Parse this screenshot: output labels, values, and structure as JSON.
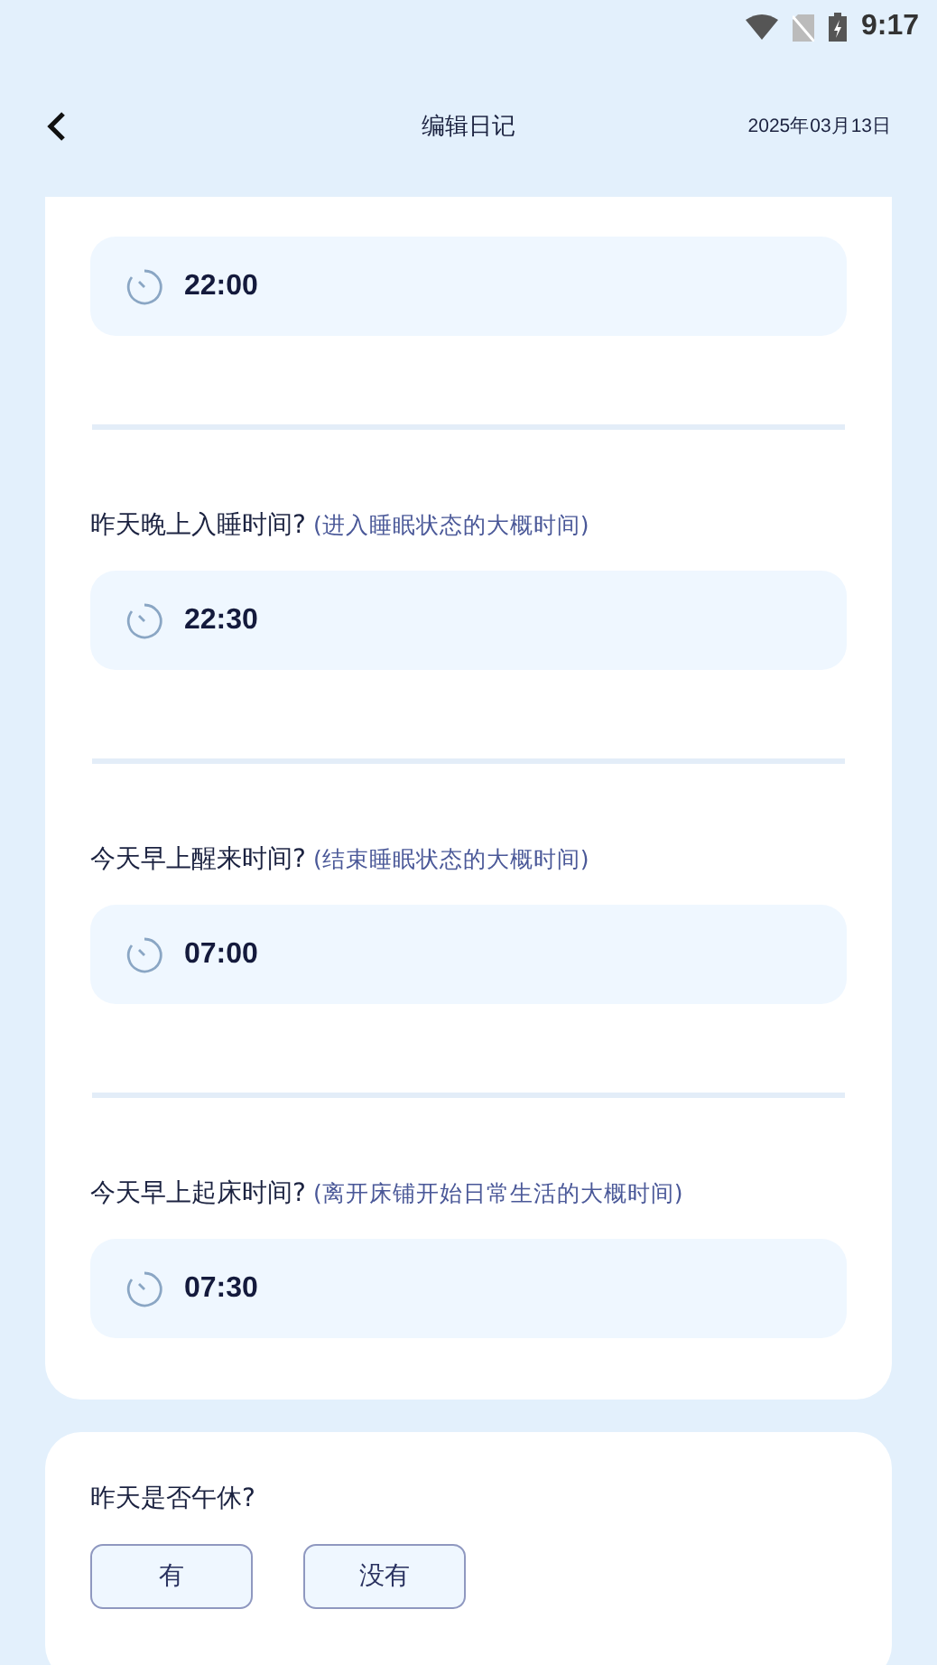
{
  "status_bar": {
    "time": "9:17"
  },
  "header": {
    "title": "编辑日记",
    "date": "2025年03月13日"
  },
  "sleep_sections": [
    {
      "time": "22:00"
    },
    {
      "question": "昨天晚上入睡时间?",
      "hint": "(进入睡眠状态的大概时间)",
      "time": "22:30"
    },
    {
      "question": "今天早上醒来时间?",
      "hint": "(结束睡眠状态的大概时间)",
      "time": "07:00"
    },
    {
      "question": "今天早上起床时间?",
      "hint": "(离开床铺开始日常生活的大概时间)",
      "time": "07:30"
    }
  ],
  "nap": {
    "question": "昨天是否午休?",
    "options": [
      "有",
      "没有"
    ]
  }
}
